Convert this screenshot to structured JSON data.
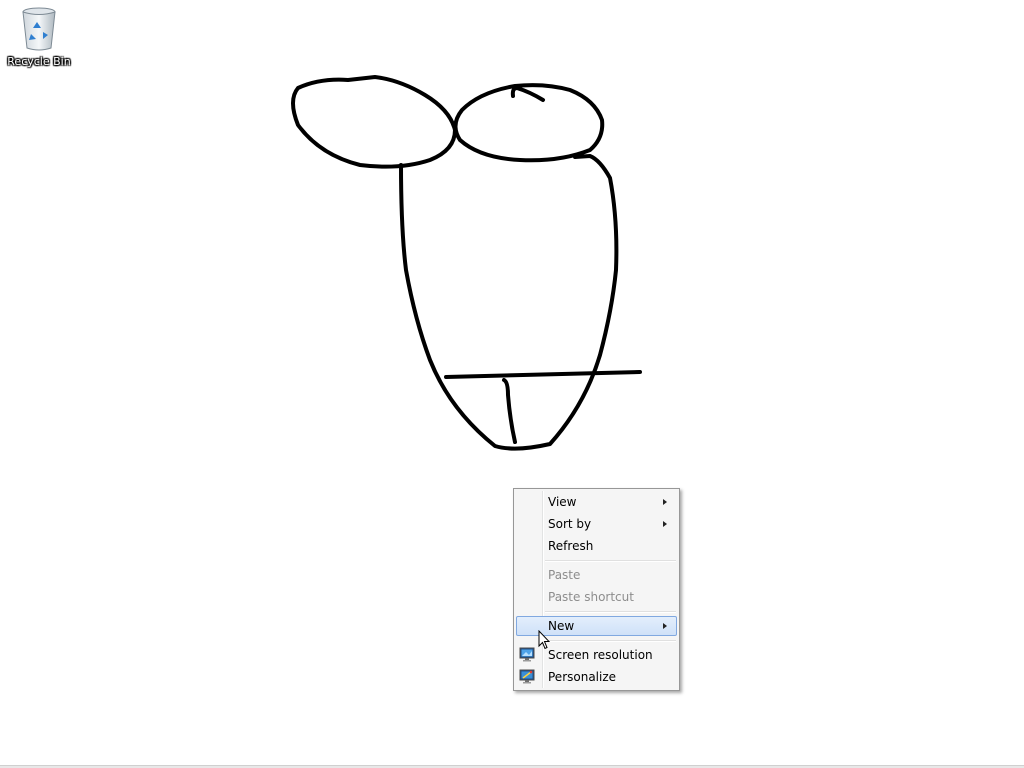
{
  "desktop": {
    "icons": [
      {
        "label": "Recycle Bin",
        "icon": "recycle-bin-icon"
      }
    ]
  },
  "context_menu": {
    "items": [
      {
        "label": "View",
        "has_submenu": true,
        "enabled": true
      },
      {
        "label": "Sort by",
        "has_submenu": true,
        "enabled": true
      },
      {
        "label": "Refresh",
        "has_submenu": false,
        "enabled": true
      },
      {
        "label": "Paste",
        "has_submenu": false,
        "enabled": false
      },
      {
        "label": "Paste shortcut",
        "has_submenu": false,
        "enabled": false
      },
      {
        "label": "New",
        "has_submenu": true,
        "enabled": true,
        "highlighted": true
      },
      {
        "label": "Screen resolution",
        "has_submenu": false,
        "enabled": true,
        "icon": "screen-resolution-icon"
      },
      {
        "label": "Personalize",
        "has_submenu": false,
        "enabled": true,
        "icon": "personalize-icon"
      }
    ]
  },
  "colors": {
    "desktop_background": "#ffffff",
    "menu_background": "#f5f5f5",
    "highlight_border": "#80a8e0",
    "disabled_text": "#8d8d8d",
    "drawing_stroke": "#000000"
  }
}
